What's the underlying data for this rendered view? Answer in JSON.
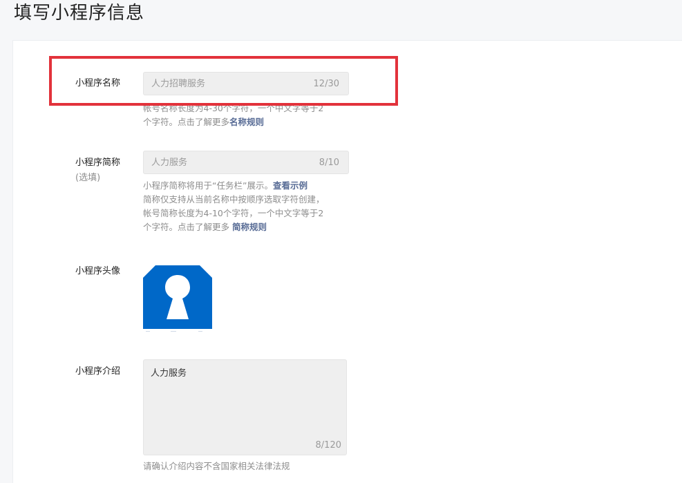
{
  "page": {
    "title": "填写小程序信息"
  },
  "name_field": {
    "label": "小程序名称",
    "value": "人力招聘服务",
    "counter": "12/30",
    "help_line1": "帐号名称长度为4-30个字符，一个中文字等于2",
    "help_line2_prefix": "个字符。点击了解更多",
    "help_link": "名称规则"
  },
  "short_name_field": {
    "label": "小程序简称",
    "sublabel": "(选填)",
    "value": "人力服务",
    "counter": "8/10",
    "help_line1_prefix": "小程序简称将用于“任务栏”展示。",
    "help_example_link": "查看示例",
    "help_line2": "简称仅支持从当前名称中按顺序选取字符创建，",
    "help_line3": "帐号简称长度为4-10个字符，一个中文字等于2",
    "help_line4_prefix": "个字符。点击了解更多 ",
    "help_link": "简称规则"
  },
  "avatar_field": {
    "label": "小程序头像",
    "icon": "keyhole-icon",
    "color": "#0068c8"
  },
  "intro_field": {
    "label": "小程序介绍",
    "value": "人力服务",
    "counter": "8/120",
    "help": "请确认介绍内容不含国家相关法律法规"
  },
  "colors": {
    "highlight": "#e2323b",
    "link": "#576b95",
    "avatar_blue": "#0068c8"
  }
}
